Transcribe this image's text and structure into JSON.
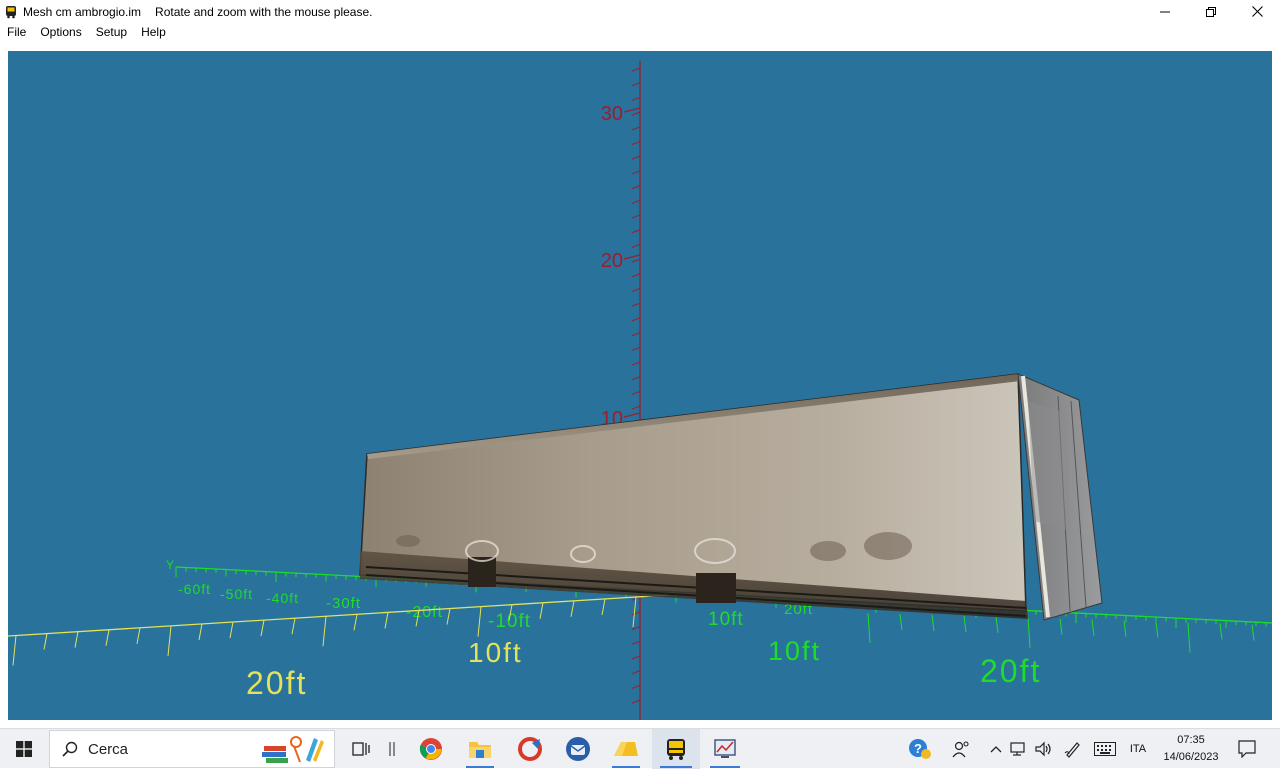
{
  "window": {
    "title": "Mesh cm ambrogio.im",
    "subtitle": "Rotate and zoom with the mouse please.",
    "minimize_icon": "minimize-icon",
    "maximize_icon": "restore-icon",
    "close_icon": "close-icon"
  },
  "menu": {
    "items": [
      "File",
      "Options",
      "Setup",
      "Help"
    ]
  },
  "scene": {
    "background": "#29729b",
    "vertical_axis_color": "#a01c2c",
    "y_axis_color": "#1fdc2a",
    "x_axis_color": "#e3e25a",
    "vertical_labels": [
      "30",
      "20",
      "10"
    ],
    "y_axis_name": "Y",
    "y_axis_labels": [
      "-60ft",
      "-50ft",
      "-40ft",
      "-30ft",
      "-20ft",
      "-10ft",
      "10ft",
      "20ft"
    ],
    "x_axis_labels": [
      "20ft",
      "10ft",
      "10ft",
      "20ft"
    ],
    "object": "semi-trailer container mesh"
  },
  "taskbar": {
    "search_placeholder": "Cerca",
    "language": "ITA",
    "time": "07:35",
    "date": "14/06/2023",
    "accent": "#3a7bd5"
  }
}
